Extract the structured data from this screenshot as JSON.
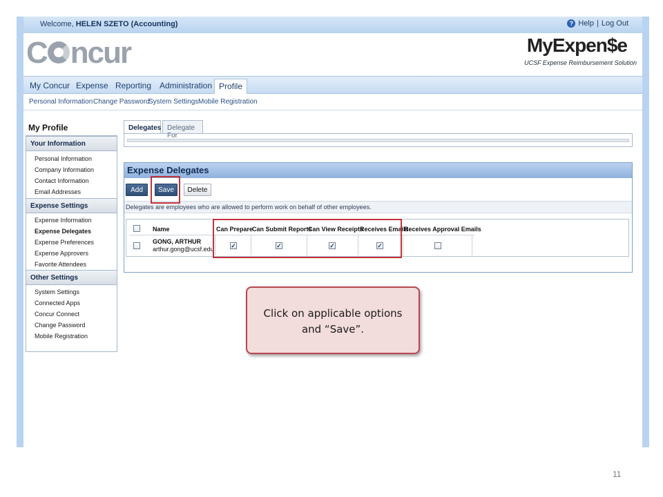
{
  "welcome": {
    "prefix": "Welcome, ",
    "user": "HELEN SZETO (Accounting)",
    "help": "Help",
    "logout": "Log Out"
  },
  "header": {
    "concur_logo_left": "C",
    "concur_logo_right": "ncur",
    "myexpense_logo": "MyExpen$e",
    "myexpense_subtitle": "UCSF Expense Reimbursement Solution"
  },
  "main_nav": [
    "My Concur",
    "Expense",
    "Reporting",
    "Administration",
    "Profile"
  ],
  "sub_nav": [
    "Personal Information",
    "Change Password",
    "System Settings",
    "Mobile Registration"
  ],
  "sidebar": {
    "title": "My Profile",
    "sections": [
      {
        "label": "Your Information",
        "items": [
          "Personal Information",
          "Company Information",
          "Contact Information",
          "Email Addresses"
        ]
      },
      {
        "label": "Expense Settings",
        "items": [
          "Expense Information",
          "Expense Delegates",
          "Expense Preferences",
          "Expense Approvers",
          "Favorite Attendees"
        ]
      },
      {
        "label": "Other Settings",
        "items": [
          "System Settings",
          "Connected Apps",
          "Concur Connect",
          "Change Password",
          "Mobile Registration"
        ]
      }
    ]
  },
  "tabs": [
    "Delegates",
    "Delegate For"
  ],
  "panel": {
    "title": "Expense Delegates",
    "buttons": {
      "add": "Add",
      "save": "Save",
      "delete": "Delete"
    },
    "info": "Delegates are employees who are allowed to perform work on behalf of other employees.",
    "columns": [
      "Name",
      "Can Prepare",
      "Can Submit Reports",
      "Can View Receipts",
      "Receives Emails",
      "Receives Approval Emails"
    ],
    "rows": [
      {
        "name": "GONG, ARTHUR",
        "email": "arthur.gong@ucsf.edu",
        "can_prepare": true,
        "can_submit_reports": true,
        "can_view_receipts": true,
        "receives_emails": true,
        "receives_approval_emails": false
      }
    ]
  },
  "callout": {
    "line1": "Click on applicable options",
    "line2": "and “Save”."
  },
  "slide_number": "11",
  "colors": {
    "highlight": "#c0323a",
    "nav_blue": "#1f3f6e",
    "callout_fill": "#f2dcdc"
  }
}
